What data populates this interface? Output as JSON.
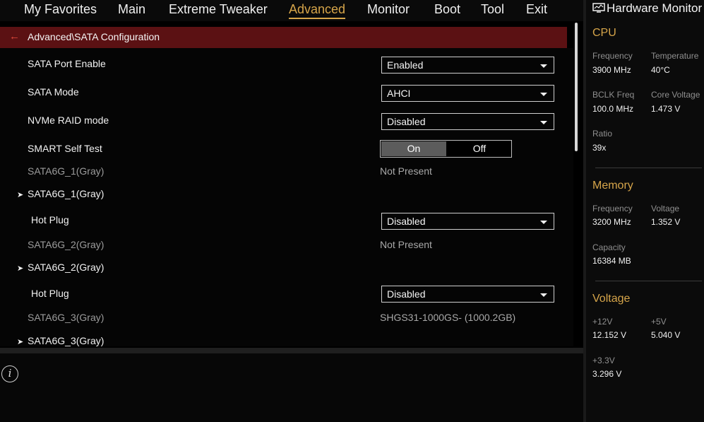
{
  "nav": {
    "items": [
      "My Favorites",
      "Main",
      "Extreme Tweaker",
      "Advanced",
      "Monitor",
      "Boot",
      "Tool",
      "Exit"
    ],
    "active": "Advanced"
  },
  "breadcrumb": "Advanced\\SATA Configuration",
  "settings": {
    "sata_port_enable": {
      "label": "SATA Port Enable",
      "value": "Enabled"
    },
    "sata_mode": {
      "label": "SATA Mode",
      "value": "AHCI"
    },
    "nvme_raid_mode": {
      "label": "NVMe RAID mode",
      "value": "Disabled"
    },
    "smart_self_test": {
      "label": "SMART Self Test",
      "on": "On",
      "off": "Off",
      "selected": "On"
    },
    "port1_info": {
      "label": "SATA6G_1(Gray)",
      "value": "Not Present"
    },
    "port1_sub": {
      "label": "SATA6G_1(Gray)"
    },
    "port1_hotplug": {
      "label": "Hot Plug",
      "value": "Disabled"
    },
    "port2_info": {
      "label": "SATA6G_2(Gray)",
      "value": "Not Present"
    },
    "port2_sub": {
      "label": "SATA6G_2(Gray)"
    },
    "port2_hotplug": {
      "label": "Hot Plug",
      "value": "Disabled"
    },
    "port3_info": {
      "label": "SATA6G_3(Gray)",
      "value": "SHGS31-1000GS- (1000.2GB)"
    },
    "port3_sub": {
      "label": "SATA6G_3(Gray)"
    }
  },
  "icons": {
    "back": "back-arrow-icon",
    "submenu": "chevron-right-icon",
    "dropdown": "caret-down-icon",
    "info": "info-icon",
    "monitor": "monitor-icon"
  },
  "hw": {
    "title": "Hardware Monitor",
    "cpu": {
      "title": "CPU",
      "frequency": {
        "label": "Frequency",
        "value": "3900 MHz"
      },
      "temperature": {
        "label": "Temperature",
        "value": "40°C"
      },
      "bclk": {
        "label": "BCLK Freq",
        "value": "100.0 MHz"
      },
      "core_voltage": {
        "label": "Core Voltage",
        "value": "1.473 V"
      },
      "ratio": {
        "label": "Ratio",
        "value": "39x"
      }
    },
    "memory": {
      "title": "Memory",
      "frequency": {
        "label": "Frequency",
        "value": "3200 MHz"
      },
      "voltage": {
        "label": "Voltage",
        "value": "1.352 V"
      },
      "capacity": {
        "label": "Capacity",
        "value": "16384 MB"
      }
    },
    "voltage": {
      "title": "Voltage",
      "v12": {
        "label": "+12V",
        "value": "12.152 V"
      },
      "v5": {
        "label": "+5V",
        "value": "5.040 V"
      },
      "v33": {
        "label": "+3.3V",
        "value": "3.296 V"
      }
    }
  },
  "colors": {
    "accent": "#d6a54a",
    "breadcrumb_bg": "#5b1113",
    "back_arrow": "#e24a3c"
  }
}
